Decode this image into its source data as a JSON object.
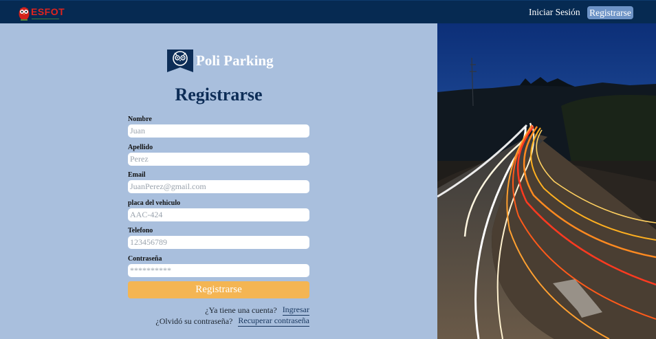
{
  "navbar": {
    "logo_text": "ESFOT",
    "login_label": "Iniciar Sesión",
    "register_label": "Registrarse"
  },
  "brand": {
    "name": "Poli Parking"
  },
  "form": {
    "title": "Registrarse",
    "fields": [
      {
        "label": "Nombre",
        "placeholder": "Juan"
      },
      {
        "label": "Apellido",
        "placeholder": "Perez"
      },
      {
        "label": "Email",
        "placeholder": "JuanPerez@gmail.com"
      },
      {
        "label": "placa del vehiculo",
        "placeholder": "AAC-424"
      },
      {
        "label": "Telefono",
        "placeholder": "123456789"
      },
      {
        "label": "Contraseña",
        "placeholder": "**********"
      }
    ],
    "submit_label": "Registrarse"
  },
  "footer_links": {
    "account_prompt": "¿Ya tiene una cuenta?",
    "login_link": "Ingresar",
    "forgot_prompt": "¿Olvidó su contraseña?",
    "recover_link": "Recuperar contraseña"
  },
  "colors": {
    "navbar": "#062a52",
    "panel": "#a9bfdd",
    "accent": "#f4b553",
    "title": "#0d2d57",
    "nav_button": "#6d93c6"
  },
  "hero_image": {
    "subject": "long-exposure light trails on highway at dusk"
  }
}
